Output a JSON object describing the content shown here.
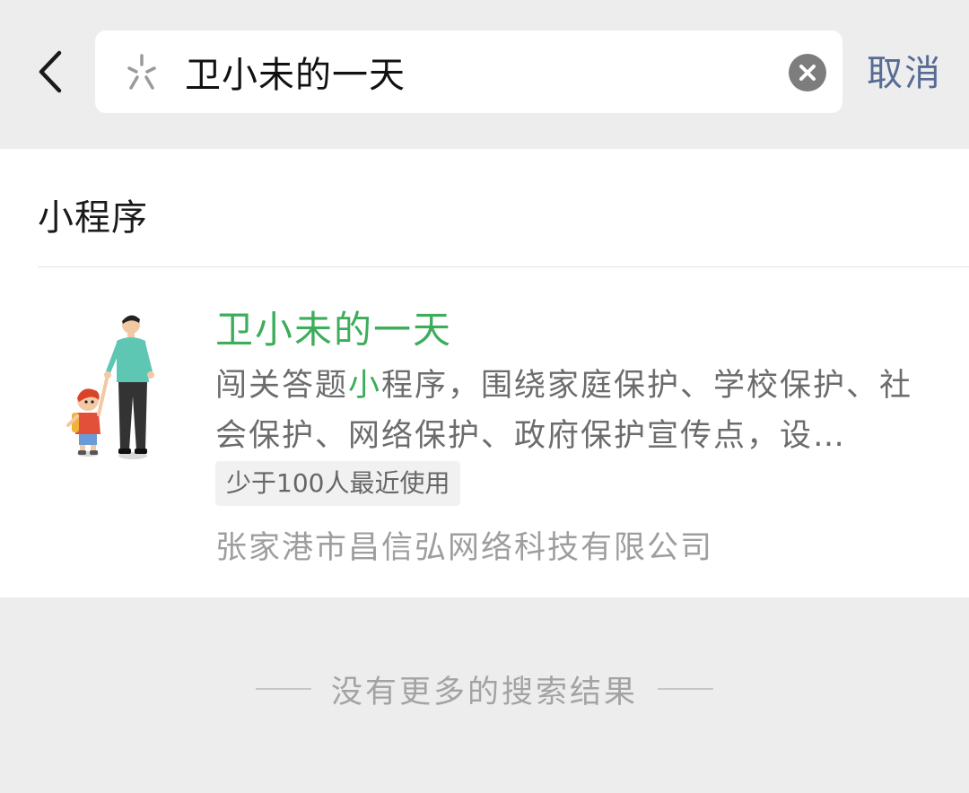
{
  "search": {
    "query": "卫小未的一天",
    "cancel_label": "取消"
  },
  "results": {
    "section_title": "小程序",
    "items": [
      {
        "name": "卫小未的一天",
        "desc_before": "闯关答题",
        "desc_highlight": "小",
        "desc_after": "程序，围绕家庭保护、学校保护、社会保护、网络保护、政府保护宣传点，设…",
        "usage": "少于100人最近使用",
        "company": "张家港市昌信弘网络科技有限公司",
        "icon": "parent-child-avatar"
      }
    ]
  },
  "footer": {
    "no_more_text": "没有更多的搜索结果"
  },
  "colors": {
    "accent_green": "#3cad5a",
    "link_blue": "#576b95",
    "background": "#ededed"
  },
  "icons": {
    "back": "chevron-left-icon",
    "search": "search-icon",
    "clear": "clear-icon"
  }
}
